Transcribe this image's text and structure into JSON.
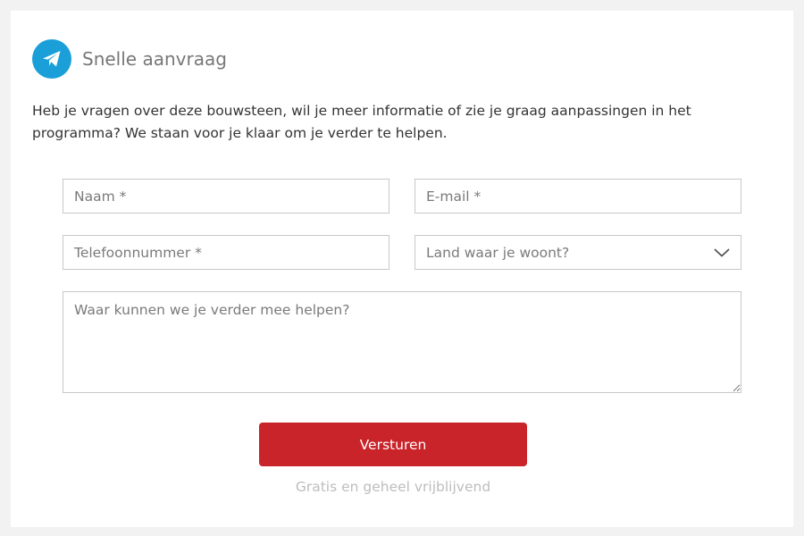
{
  "header": {
    "icon": "paper-plane-icon",
    "title": "Snelle aanvraag",
    "accent_color": "#1a9fd9"
  },
  "intro": "Heb je vragen over deze bouwsteen, wil je meer informatie of zie je graag aanpassingen in het programma? We staan voor je klaar om je verder te helpen.",
  "form": {
    "name_placeholder": "Naam *",
    "email_placeholder": "E-mail *",
    "phone_placeholder": "Telefoonnummer *",
    "country_placeholder": "Land waar je woont?",
    "country_icon": "chevron-down-icon",
    "message_placeholder": "Waar kunnen we je verder mee helpen?",
    "submit_label": "Versturen",
    "submit_color": "#c9242a",
    "note": "Gratis en geheel vrijblijvend"
  }
}
